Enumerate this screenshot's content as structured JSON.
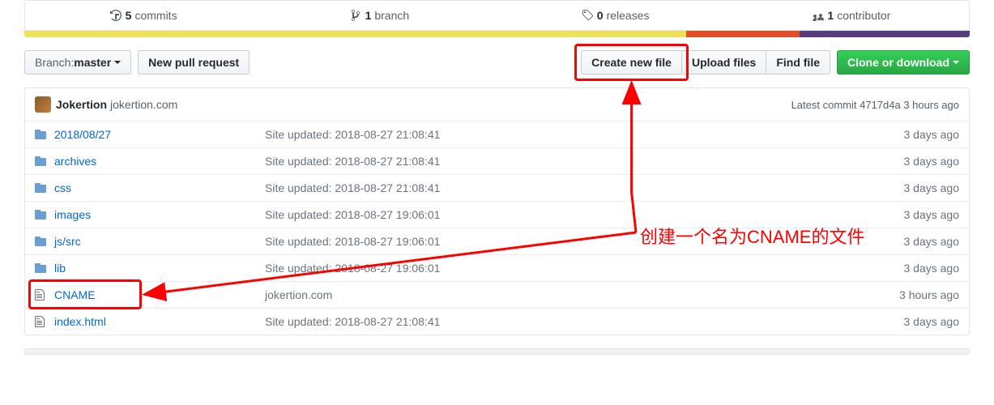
{
  "stats": {
    "commits": {
      "count": "5",
      "label": "commits"
    },
    "branches": {
      "count": "1",
      "label": "branch"
    },
    "releases": {
      "count": "0",
      "label": "releases"
    },
    "contributors": {
      "count": "1",
      "label": "contributor"
    }
  },
  "language_bar": [
    {
      "color": "#f1e05a",
      "width": 70
    },
    {
      "color": "#e34c26",
      "width": 12
    },
    {
      "color": "#563d7c",
      "width": 18
    }
  ],
  "toolbar": {
    "branch_prefix": "Branch: ",
    "branch_name": "master",
    "new_pr": "New pull request",
    "create_file": "Create new file",
    "upload_files": "Upload files",
    "find_file": "Find file",
    "clone": "Clone or download"
  },
  "commit": {
    "author": "Jokertion",
    "message": "jokertion.com",
    "meta_prefix": "Latest commit ",
    "sha": "4717d4a",
    "time": " 3 hours ago"
  },
  "files": [
    {
      "type": "dir",
      "name": "2018/08/27",
      "msg": "Site updated: 2018-08-27 21:08:41",
      "age": "3 days ago"
    },
    {
      "type": "dir",
      "name": "archives",
      "msg": "Site updated: 2018-08-27 21:08:41",
      "age": "3 days ago"
    },
    {
      "type": "dir",
      "name": "css",
      "msg": "Site updated: 2018-08-27 21:08:41",
      "age": "3 days ago"
    },
    {
      "type": "dir",
      "name": "images",
      "msg": "Site updated: 2018-08-27 19:06:01",
      "age": "3 days ago"
    },
    {
      "type": "dir",
      "name": "js/src",
      "msg": "Site updated: 2018-08-27 19:06:01",
      "age": "3 days ago"
    },
    {
      "type": "dir",
      "name": "lib",
      "msg": "Site updated: 2018-08-27 19:06:01",
      "age": "3 days ago"
    },
    {
      "type": "file",
      "name": "CNAME",
      "msg": "jokertion.com",
      "age": "3 hours ago"
    },
    {
      "type": "file",
      "name": "index.html",
      "msg": "Site updated: 2018-08-27 21:08:41",
      "age": "3 days ago"
    }
  ],
  "annotation": {
    "label": "创建一个名为CNAME的文件"
  }
}
